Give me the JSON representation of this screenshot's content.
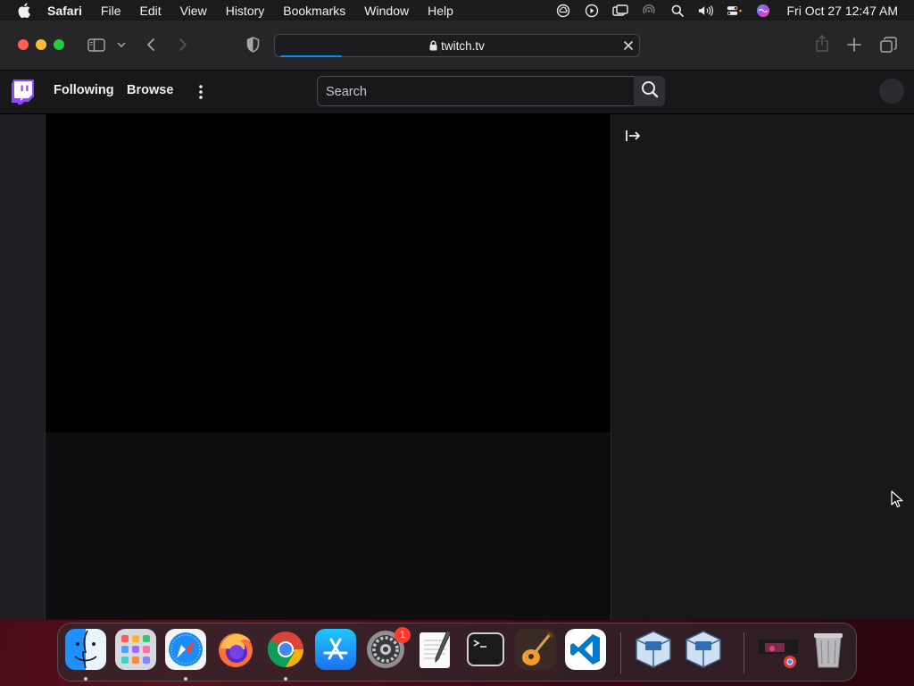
{
  "menubar": {
    "app_name": "Safari",
    "items": [
      "File",
      "Edit",
      "View",
      "History",
      "Bookmarks",
      "Window",
      "Help"
    ],
    "clock": "Fri Oct 27  12:47 AM"
  },
  "browser": {
    "url": "twitch.tv",
    "load_progress": 0.17
  },
  "twitch": {
    "nav": {
      "following": "Following",
      "browse": "Browse"
    },
    "search": {
      "placeholder": "Search"
    },
    "brand_color": "#9146ff"
  },
  "dock": {
    "apps": [
      "Finder",
      "Launchpad",
      "Safari",
      "Firefox",
      "Chrome",
      "App Store",
      "System Settings",
      "TextEdit",
      "Terminal",
      "GarageBand",
      "Visual Studio Code",
      "VirtualBox",
      "VirtualBox",
      "Chrome Window",
      "Trash"
    ],
    "system_settings_badge": "1"
  }
}
